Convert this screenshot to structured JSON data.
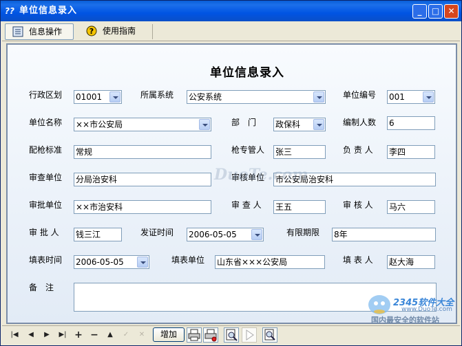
{
  "window": {
    "title": "单位信息录入",
    "title_icon_glyph": "??"
  },
  "toolbar": {
    "items": [
      {
        "label": "信息操作",
        "icon": "list-icon",
        "active": true
      },
      {
        "label": "使用指南",
        "icon": "help-icon",
        "active": false
      }
    ]
  },
  "form": {
    "title": "单位信息录入",
    "labels": {
      "region": "行政区划",
      "system": "所属系统",
      "unit_code": "单位编号",
      "unit_name": "单位名称",
      "department": "部　门",
      "staff_count": "编制人数",
      "gun_standard": "配枪标准",
      "gun_keeper": "枪专管人",
      "responsible": "负 责 人",
      "review_unit": "审查单位",
      "audit_unit": "审核单位",
      "approve_unit": "审批单位",
      "reviewer": "审 查 人",
      "auditor": "审 核 人",
      "approver": "审 批 人",
      "issue_date": "发证时间",
      "valid_period": "有限期限",
      "fill_date": "填表时间",
      "fill_unit": "填表单位",
      "filler": "填 表 人",
      "remarks": "备　注"
    },
    "values": {
      "region": "01001",
      "system": "公安系统",
      "unit_code": "001",
      "unit_name": "××市公安局",
      "department": "政保科",
      "staff_count": "6",
      "gun_standard": "常规",
      "gun_keeper": "张三",
      "responsible": "李四",
      "review_unit": "分局治安科",
      "audit_unit": "市公安局治安科",
      "approve_unit": "××市治安科",
      "reviewer": "王五",
      "auditor": "马六",
      "approver": "钱三江",
      "issue_date": "2006-05-05",
      "valid_period": "8年",
      "fill_date": "2006-05-05",
      "fill_unit": "山东省×××公安局",
      "filler": "赵大海",
      "remarks": ""
    }
  },
  "navbar": {
    "add_label": "增加",
    "glyphs": {
      "first": "|◀",
      "prev": "◀",
      "next": "▶",
      "last": "▶|",
      "insert": "+",
      "delete": "−",
      "edit": "▲",
      "post": "✓",
      "cancel": "✕"
    }
  },
  "watermark": {
    "center": "DuoTe.com",
    "brand": "2345软件大全",
    "url": "www.DuoTe.com",
    "slogan": "国内最安全的软件站"
  },
  "colors": {
    "title_bar": "#0054e3",
    "panel_border": "#7a8da8",
    "field_border": "#7f9db9",
    "close_button": "#d6461e"
  }
}
